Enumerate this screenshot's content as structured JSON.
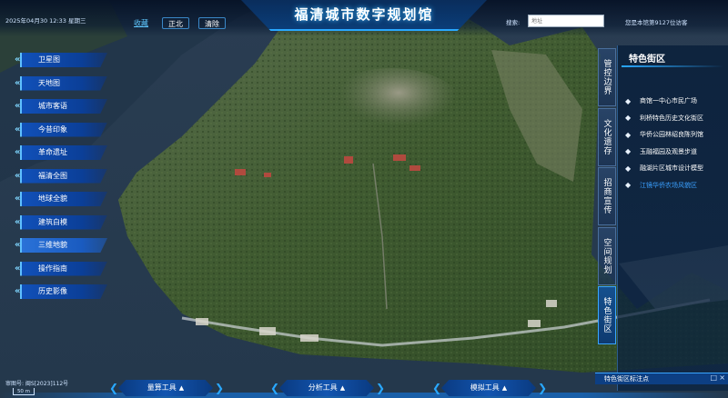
{
  "header": {
    "title": "福清城市数字规划馆",
    "datetime": "2025年04月30 12:33 星期三",
    "nav": {
      "favorite": "收藏",
      "north": "正北",
      "clear": "清除"
    },
    "search_label": "搜索:",
    "search_placeholder": "地址",
    "visitor_text": "您是本馆第9127位访客"
  },
  "left_menu": [
    {
      "label": "卫星图"
    },
    {
      "label": "天地图"
    },
    {
      "label": "城市客语"
    },
    {
      "label": "今昔印象"
    },
    {
      "label": "革命遗址"
    },
    {
      "label": "福清全图"
    },
    {
      "label": "地球全貌"
    },
    {
      "label": "建筑白模"
    },
    {
      "label": "三维地貌",
      "active": true
    },
    {
      "label": "操作指南"
    },
    {
      "label": "历史影像"
    }
  ],
  "right_tabs": [
    {
      "label": "管控边界"
    },
    {
      "label": "文化遗存"
    },
    {
      "label": "招商宣传"
    },
    {
      "label": "空间规划"
    },
    {
      "label": "特色街区",
      "active": true
    }
  ],
  "right_panel": {
    "title": "特色街区",
    "items": [
      {
        "label": "商馆一中心市民广场"
      },
      {
        "label": "利桥特色历史文化街区"
      },
      {
        "label": "华侨公园林绍良陈列馆"
      },
      {
        "label": "玉融福园及观景步道"
      },
      {
        "label": "融湖片区城市设计模型"
      },
      {
        "label": "江镜华侨农场风貌区",
        "selected": true
      }
    ],
    "marker_label": "特色街区标注点",
    "marker_win_icon": "□",
    "marker_close_icon": "×"
  },
  "bottom": {
    "map_number": "审图号: 闽S[2023]112号",
    "scale": "50 m",
    "tools": [
      {
        "label": "量算工具"
      },
      {
        "label": "分析工具"
      },
      {
        "label": "模拟工具"
      }
    ]
  },
  "colors": {
    "accent": "#29a8ff",
    "menu_blue": "#1150b8",
    "panel_bg": "#081e3a"
  }
}
